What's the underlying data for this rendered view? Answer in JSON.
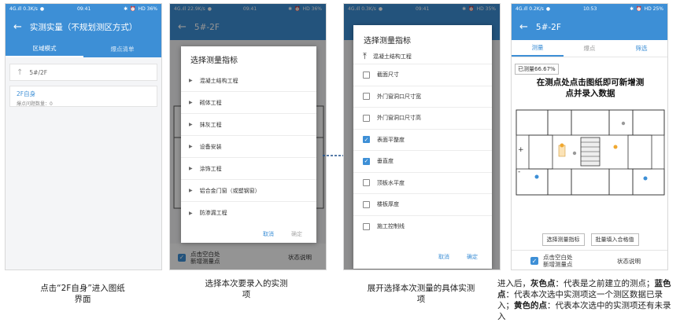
{
  "status_bars": [
    {
      "left": "4G.ıll 0.3K/s",
      "time": "09:41",
      "right": "HD 36%"
    },
    {
      "left": "4G.ıll 22.9K/s",
      "time": "09:41",
      "right": "HD 36%"
    },
    {
      "left": "4G.ıll 0.3K/s",
      "time": "09:41",
      "right": "HD 35%"
    },
    {
      "left": "4G.ıll 0.2K/s",
      "time": "10:53",
      "right": "HD 25%"
    }
  ],
  "screen1": {
    "title": "实测实量（不规划测区方式）",
    "tabs": [
      "区域模式",
      "爆点清单"
    ],
    "path": "5#/2F",
    "item_title": "2F自身",
    "item_sub": "爆点问题数量：0"
  },
  "screen2": {
    "title": "5#-2F",
    "dialog_title": "选择测量指标",
    "options": [
      "混凝土结构工程",
      "砌体工程",
      "抹灰工程",
      "设备安装",
      "涂饰工程",
      "铝合金门窗（或塑钢窗）",
      "防渗漏工程"
    ],
    "cancel": "取消",
    "ok": "确定",
    "bottom_check_text_1": "点击空白处",
    "bottom_check_text_2": "新增测量点",
    "status_link": "状态说明"
  },
  "screen3": {
    "dialog_title": "选择测量指标",
    "parent": "混凝土结构工程",
    "options": [
      {
        "label": "截面尺寸",
        "checked": false
      },
      {
        "label": "外门窗洞口尺寸宽",
        "checked": false
      },
      {
        "label": "外门窗洞口尺寸高",
        "checked": false
      },
      {
        "label": "表面平整度",
        "checked": true
      },
      {
        "label": "垂直度",
        "checked": true
      },
      {
        "label": "顶板水平度",
        "checked": false
      },
      {
        "label": "楼板厚度",
        "checked": false
      },
      {
        "label": "施工控制线",
        "checked": false
      }
    ],
    "cancel": "取消",
    "ok": "确定"
  },
  "screen4": {
    "title": "5#-2F",
    "tabs": [
      "测量",
      "爆点",
      "筛选"
    ],
    "measured": "已测量66.67%",
    "hint_line1": "在测点处点击图纸即可新增测",
    "hint_line2": "点并录入数据",
    "zoom_in": "+",
    "zoom_out": "-",
    "btn_select": "选择测量指标",
    "btn_batch": "批量填入合格值",
    "bottom_check_text_1": "点击空白处",
    "bottom_check_text_2": "新增测量点",
    "status_link": "状态说明"
  },
  "captions": {
    "c1_line1": "点击“2F自身”进入图纸",
    "c1_line2": "界面",
    "c2_line1": "选择本次要录入的实测",
    "c2_line2": "项",
    "c3_line1": "展开选择本次测量的具体实测",
    "c3_line2": "项",
    "c4_p1": "进入后，",
    "c4_b1": "灰色点",
    "c4_p2": "：代表是之前建立的测点；",
    "c4_b2": "蓝色点",
    "c4_p3": "：代表本次选中实测项这一个测区数据已录入；",
    "c4_b3": "黄色的点",
    "c4_p4": "：代表本次选中的实测项还有未录入"
  }
}
